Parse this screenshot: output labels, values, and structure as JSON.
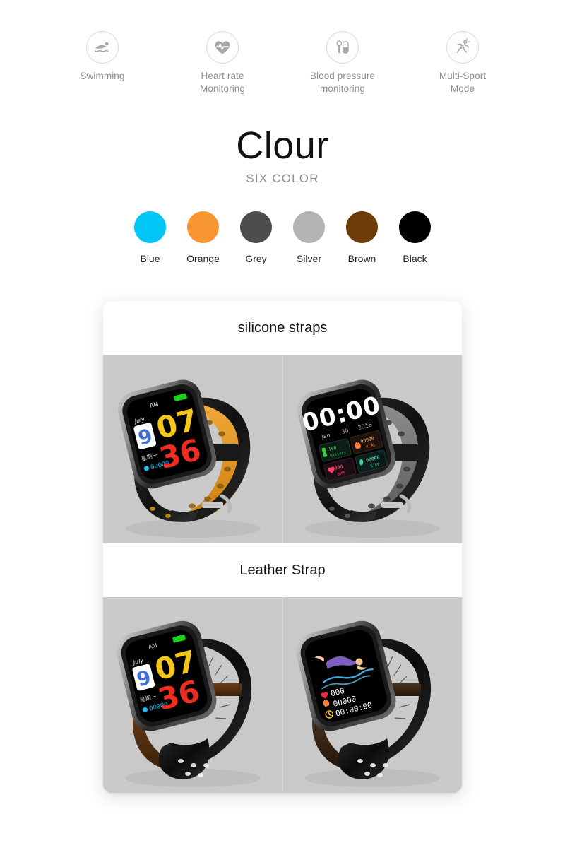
{
  "features": [
    {
      "icon": "swimming-icon",
      "label": "Swimming"
    },
    {
      "icon": "heart-rate-icon",
      "label": "Heart rate\nMonitoring"
    },
    {
      "icon": "blood-pressure-icon",
      "label": "Blood pressure\nmonitoring"
    },
    {
      "icon": "running-icon",
      "label": "Multi-Sport\nMode"
    }
  ],
  "brand": {
    "title": "Clour",
    "subtitle": "SIX COLOR"
  },
  "colors": [
    {
      "label": "Blue",
      "hex": "#00c6f5"
    },
    {
      "label": "Orange",
      "hex": "#f79632"
    },
    {
      "label": "Grey",
      "hex": "#4d4d4d"
    },
    {
      "label": "Silver",
      "hex": "#b4b4b4"
    },
    {
      "label": "Brown",
      "hex": "#6e3c07"
    },
    {
      "label": "Black",
      "hex": "#000000"
    }
  ],
  "card": {
    "sections": [
      {
        "heading": "silicone straps",
        "panels": [
          {
            "name": "watch-silicone-orange",
            "strap_outer": "#1b1b1b",
            "strap_inner": "#e09b28",
            "watchface": {
              "type": "time-large",
              "meridiem": "AM",
              "battery": "battery-full-icon",
              "month": "July",
              "day": "9",
              "weekday": "星期一",
              "hour": "07",
              "minute": "36",
              "steps": "00000",
              "steps_icon": "footprint-icon"
            }
          },
          {
            "name": "watch-silicone-grey",
            "strap_outer": "#1b1b1b",
            "strap_inner": "#6d6d6d",
            "watchface": {
              "type": "dashboard",
              "time": "00:00",
              "date_month": "Jan",
              "date_day": "30",
              "date_year": "2018",
              "tiles": [
                {
                  "icon": "battery-icon",
                  "value": "100",
                  "unit": "Battery",
                  "color": "#3ad13a"
                },
                {
                  "icon": "flame-icon",
                  "value": "00000",
                  "unit": "KCAL",
                  "color": "#ff7a33"
                },
                {
                  "icon": "heart-icon",
                  "value": "000",
                  "unit": "BPM",
                  "color": "#ff3b6b"
                },
                {
                  "icon": "footprint-icon",
                  "value": "00000",
                  "unit": "STEP",
                  "color": "#2fd6a6"
                }
              ]
            }
          }
        ]
      },
      {
        "heading": "Leather Strap",
        "panels": [
          {
            "name": "watch-leather-brown",
            "strap_outer": "#171717",
            "strap_inner": "#4a2a13",
            "watchface": {
              "type": "time-large",
              "meridiem": "AM",
              "battery": "battery-full-icon",
              "month": "July",
              "day": "9",
              "weekday": "星期一",
              "hour": "07",
              "minute": "36",
              "steps": "00000",
              "steps_icon": "footprint-icon"
            }
          },
          {
            "name": "watch-leather-black",
            "strap_outer": "#171717",
            "strap_inner": "#3a2a1c",
            "watchface": {
              "type": "swim",
              "graphic": "swimmer-diving-graphic",
              "rows": [
                {
                  "icon": "heart-icon",
                  "value": "000"
                },
                {
                  "icon": "flame-icon",
                  "value": "00000"
                },
                {
                  "icon": "stopwatch-icon",
                  "value": "00:00:00"
                }
              ]
            }
          }
        ]
      }
    ]
  }
}
